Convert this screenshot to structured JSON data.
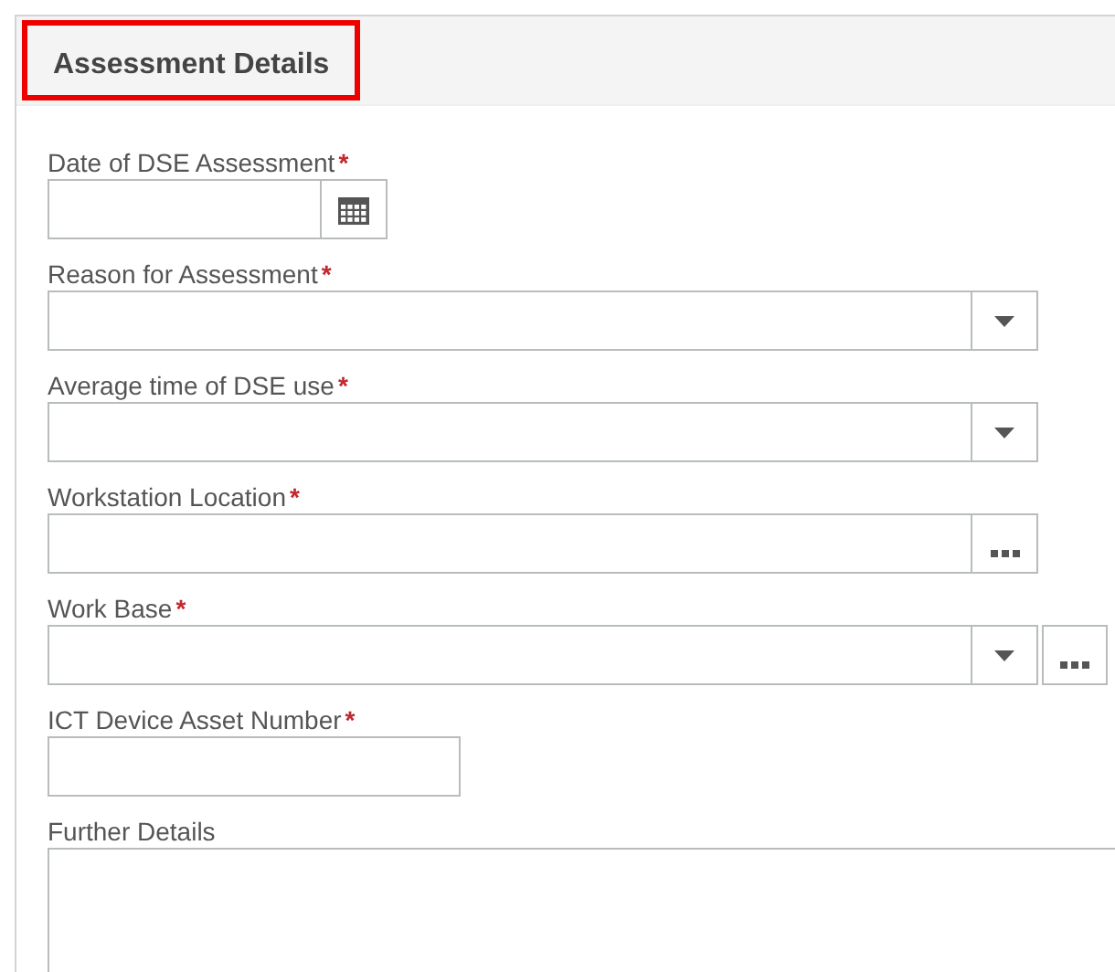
{
  "section": {
    "title": "Assessment Details",
    "highlighted": true
  },
  "fields": [
    {
      "label": "Date of DSE Assessment",
      "required": true,
      "kind": "date"
    },
    {
      "label": "Reason for Assessment",
      "required": true,
      "kind": "select"
    },
    {
      "label": "Average time of DSE use",
      "required": true,
      "kind": "select"
    },
    {
      "label": "Workstation Location",
      "required": true,
      "kind": "lookup"
    },
    {
      "label": "Work Base",
      "required": true,
      "kind": "select_lookup"
    },
    {
      "label": "ICT Device Asset Number",
      "required": true,
      "kind": "text"
    },
    {
      "label": "Further Details",
      "required": false,
      "kind": "textarea"
    }
  ],
  "required_mark": "*"
}
